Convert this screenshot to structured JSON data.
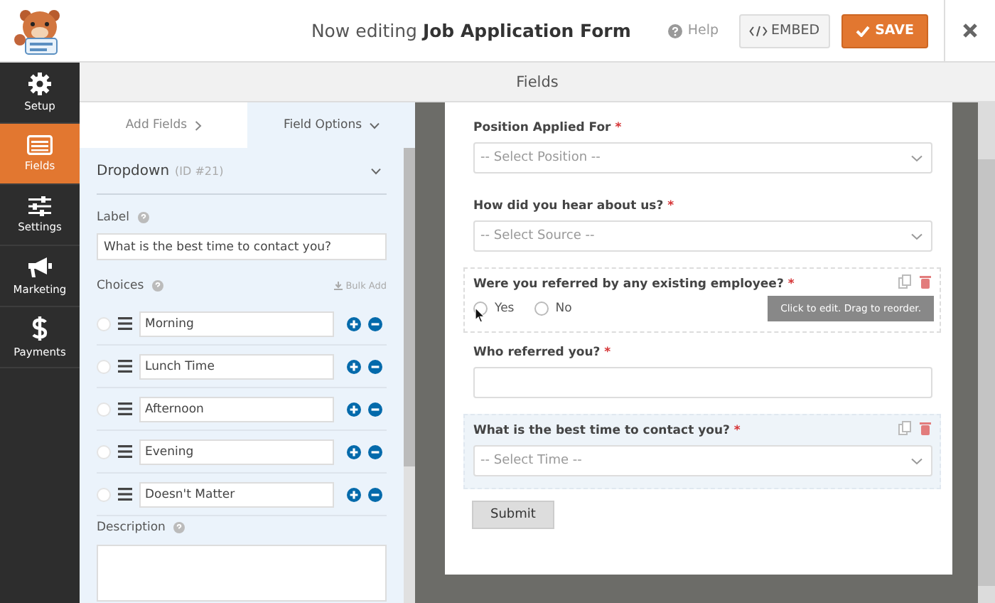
{
  "header": {
    "title": "Now editing **Job Application Form**",
    "help": "Help",
    "embed": "EMBED",
    "save": "SAVE"
  },
  "sidebar": {
    "items": [
      {
        "kind": "setup",
        "label": "Setup",
        "selected": false
      },
      {
        "kind": "fields",
        "label": "Fields",
        "selected": true
      },
      {
        "kind": "settings",
        "label": "Settings",
        "selected": false
      },
      {
        "kind": "marketing",
        "label": "Marketing",
        "selected": false
      },
      {
        "kind": "payments",
        "label": "Payments",
        "selected": false
      }
    ]
  },
  "section_title": "Fields",
  "panel": {
    "tabs": [
      {
        "label": "Add Fields",
        "selected": false
      },
      {
        "label": "Field Options",
        "selected": true
      }
    ],
    "field_type": "Dropdown",
    "field_id": "(ID #21)",
    "expanded": true,
    "label_title": "Label",
    "label_value": "What is the best time to contact you?",
    "choices_title": "Choices",
    "bulk_add": "Bulk Add",
    "choices": [
      {
        "value": "Morning",
        "selected": false
      },
      {
        "value": "Lunch Time",
        "selected": false
      },
      {
        "value": "Afternoon",
        "selected": false
      },
      {
        "value": "Evening",
        "selected": false
      },
      {
        "value": "Doesn't Matter",
        "selected": false
      }
    ],
    "description_title": "Description"
  },
  "form": {
    "fields": [
      {
        "kind": "select",
        "label": "Position Applied For",
        "required_mark": "*",
        "placeholder": "-- Select Position --",
        "highlighted": false,
        "hovered": false
      },
      {
        "kind": "select",
        "label": "How did you hear about us?",
        "required_mark": "*",
        "placeholder": "-- Select Source --",
        "highlighted": false,
        "hovered": false
      },
      {
        "kind": "radio",
        "label": "Were you referred by any existing employee?",
        "required_mark": "*",
        "options": [
          {
            "label": "Yes",
            "selected": false
          },
          {
            "label": "No",
            "selected": false
          }
        ],
        "highlighted": false,
        "hovered": true
      },
      {
        "kind": "text",
        "label": "Who referred you?",
        "required_mark": "*",
        "highlighted": false,
        "hovered": false
      },
      {
        "kind": "select",
        "label": "What is the best time to contact you?",
        "required_mark": "*",
        "placeholder": "-- Select Time --",
        "highlighted": true,
        "hovered": false
      }
    ],
    "tooltip": "Click to edit. Drag to reorder.",
    "submit": "Submit"
  }
}
